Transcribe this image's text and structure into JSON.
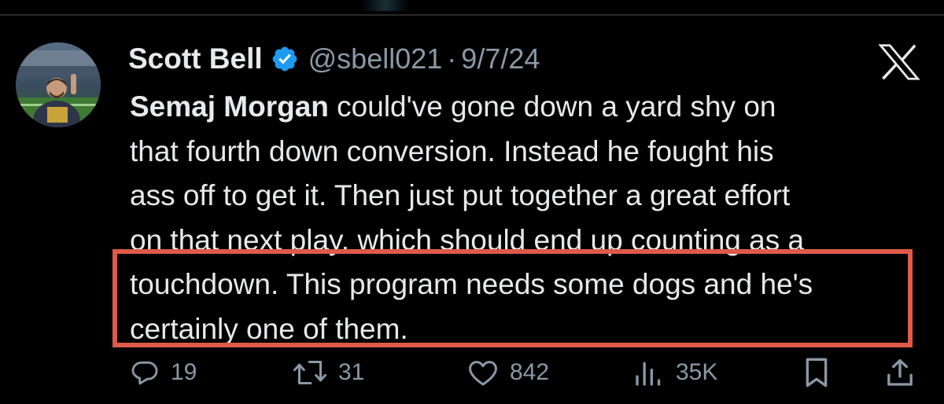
{
  "tweet": {
    "author_name": "Scott Bell",
    "handle": "@sbell021",
    "separator": "·",
    "date": "9/7/24",
    "verified": true,
    "body_lines": [
      {
        "mention": "Semaj Morgan",
        "text": " could've gone down a yard shy on"
      },
      {
        "mention": "",
        "text": "that fourth down conversion. Instead he fought his"
      },
      {
        "mention": "",
        "text": "ass off to get it. Then just put together a great effort"
      },
      {
        "mention": "",
        "text": "on that next play, which should end up counting as a"
      },
      {
        "mention": "",
        "text": "touchdown. This program needs some dogs and he's"
      },
      {
        "mention": "",
        "text": "certainly one of them."
      }
    ]
  },
  "actions": {
    "replies": "19",
    "retweets": "31",
    "likes": "842",
    "views": "35K"
  },
  "icons": {
    "verified": "verified-badge-icon",
    "platform": "x-logo-icon",
    "reply": "reply-icon",
    "retweet": "retweet-icon",
    "like": "heart-icon",
    "views": "views-icon",
    "bookmark": "bookmark-icon",
    "share": "share-icon"
  },
  "colors": {
    "background": "#000000",
    "text": "#e7e9ea",
    "muted": "#8b98a5",
    "verified_blue": "#1d9bf0",
    "highlight_border": "#df5a48"
  }
}
